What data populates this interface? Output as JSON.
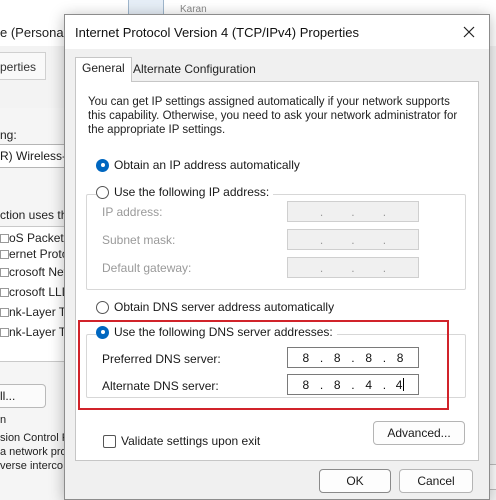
{
  "background_window": {
    "title": "e (Personal",
    "tab": "perties",
    "user": "Karan",
    "connect_label": "ng:",
    "adapter": "R) Wireless-A",
    "uses_label": "ction uses the",
    "items": [
      "oS Packet Sc",
      "ernet Protoco",
      "crosoft Netwo",
      "crosoft LLDP",
      "nk-Layer Topo",
      "nk-Layer Topo"
    ],
    "install_button": "ll...",
    "description_heading": "n",
    "description_lines": [
      "sion Control F",
      "a network pro",
      "verse interco"
    ]
  },
  "dialog": {
    "title": "Internet Protocol Version 4 (TCP/IPv4) Properties",
    "tabs": [
      {
        "label": "General",
        "active": true
      },
      {
        "label": "Alternate Configuration",
        "active": false
      }
    ],
    "description": "You can get IP settings assigned automatically if your network supports this capability. Otherwise, you need to ask your network administrator for the appropriate IP settings.",
    "ip_auto_label": "Obtain an IP address automatically",
    "ip_manual_label": "Use the following IP address:",
    "ip_mode": "automatic",
    "ip_fields": [
      {
        "label": "IP address:"
      },
      {
        "label": "Subnet mask:"
      },
      {
        "label": "Default gateway:"
      }
    ],
    "dns_auto_label": "Obtain DNS server address automatically",
    "dns_manual_label": "Use the following DNS server addresses:",
    "dns_mode": "manual",
    "dns_fields": [
      {
        "label": "Preferred DNS server:",
        "octets": [
          "8",
          "8",
          "8",
          "8"
        ]
      },
      {
        "label": "Alternate DNS server:",
        "octets": [
          "8",
          "8",
          "4",
          "4"
        ]
      }
    ],
    "validate_label": "Validate settings upon exit",
    "validate_checked": false,
    "advanced_button": "Advanced...",
    "ok_button": "OK",
    "cancel_button": "Cancel",
    "highlight_color": "#d1232a",
    "accent_color": "#0067c0"
  }
}
